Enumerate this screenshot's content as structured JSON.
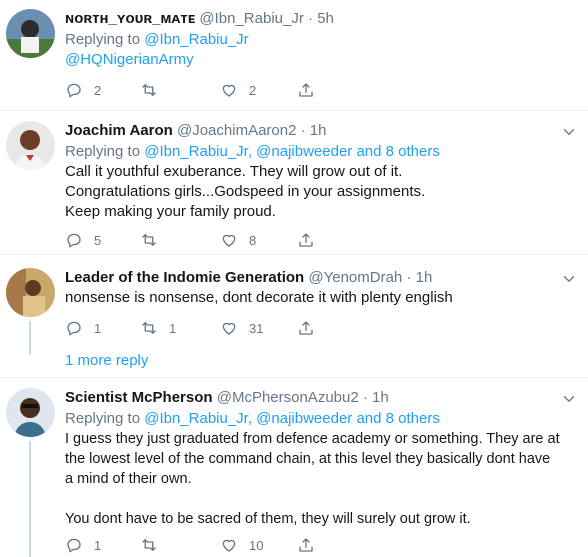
{
  "tweets": [
    {
      "name": "ɴᴏʀᴛʜ_ʏᴏᴜʀ_ᴍᴀᴛᴇ",
      "handle": "@Ibn_Rabiu_Jr",
      "dot": "·",
      "time": "5h",
      "replying_prefix": "Replying to",
      "replying_users": "@Ibn_Rabiu_Jr",
      "text_lines": [
        "@HQNigerianArmy"
      ],
      "replies": "2",
      "retweets": "",
      "likes": "2"
    },
    {
      "name": "Joachim Aaron",
      "handle": "@JoachimAaron2",
      "dot": "·",
      "time": "1h",
      "replying_prefix": "Replying to",
      "replying_users": "@Ibn_Rabiu_Jr, @najibweeder and 8 others",
      "text_lines": [
        "Call it youthful exuberance. They will grow out of it.",
        "Congratulations girls...Godspeed in your assignments.",
        "Keep making your family proud."
      ],
      "replies": "5",
      "retweets": "",
      "likes": "8"
    },
    {
      "name": "Leader of the Indomie Generation",
      "handle": "@YenomDrah",
      "dot": "·",
      "time": "1h",
      "text_lines": [
        "nonsense is nonsense, dont decorate it with plenty english"
      ],
      "replies": "1",
      "retweets": "1",
      "likes": "31"
    },
    {
      "name": "Scientist McPherson",
      "handle": "@McPhersonAzubu2",
      "dot": "·",
      "time": "1h",
      "replying_prefix": "Replying to",
      "replying_users": "@Ibn_Rabiu_Jr, @najibweeder and 8 others",
      "text_lines": [
        "I guess they just graduated from defence academy or something. They are at",
        "the lowest level of the command chain, at this level they basically dont have",
        "a mind of their own.",
        "",
        "You dont have to be sacred of them, they will surely out grow it."
      ],
      "replies": "1",
      "retweets": "",
      "likes": "10"
    }
  ],
  "more_reply": "1 more reply",
  "colors": {
    "link": "#1da1f2",
    "muted": "#657786",
    "line": "#ccd6dd",
    "separator": "#e6ecf0"
  },
  "icons": [
    "reply-icon",
    "retweet-icon",
    "like-icon",
    "share-icon",
    "caret-down-icon"
  ]
}
